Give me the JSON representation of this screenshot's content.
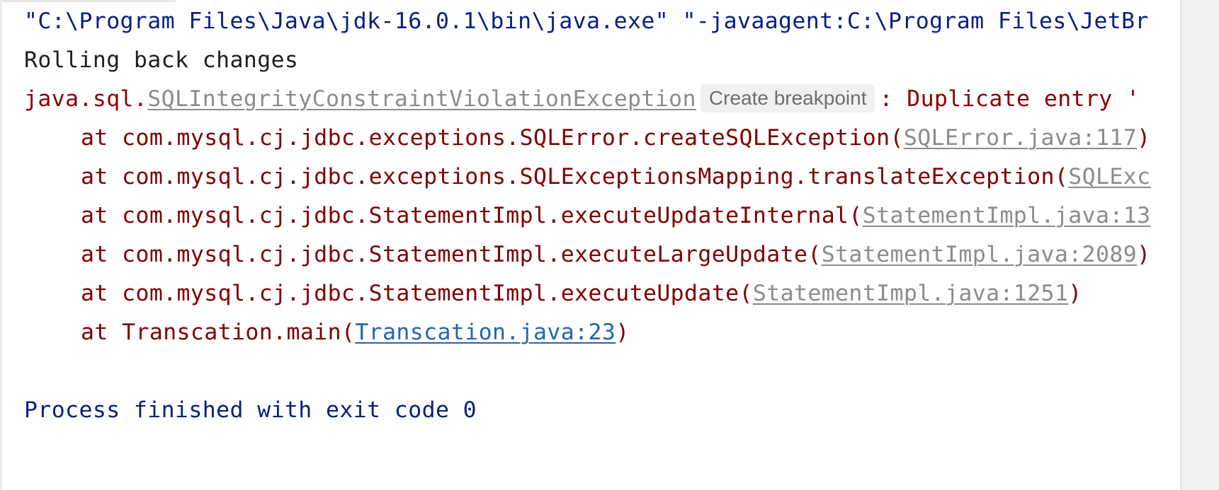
{
  "console": {
    "command_line": "\"C:\\Program Files\\Java\\jdk-16.0.1\\bin\\java.exe\" \"-javaagent:C:\\Program Files\\JetBr",
    "rollback_message": "Rolling back changes",
    "exception": {
      "prefix": "java.sql.",
      "class_name": "SQLIntegrityConstraintViolationException",
      "breakpoint_label": "Create breakpoint",
      "message": ": Duplicate entry '"
    },
    "stack_trace": [
      {
        "method": "at com.mysql.cj.jdbc.exceptions.SQLError.createSQLException(",
        "source": "SQLError.java:117",
        "suffix": ")"
      },
      {
        "method": "at com.mysql.cj.jdbc.exceptions.SQLExceptionsMapping.translateException(",
        "source": "SQLExc",
        "suffix": ""
      },
      {
        "method": "at com.mysql.cj.jdbc.StatementImpl.executeUpdateInternal(",
        "source": "StatementImpl.java:13",
        "suffix": ""
      },
      {
        "method": "at com.mysql.cj.jdbc.StatementImpl.executeLargeUpdate(",
        "source": "StatementImpl.java:2089",
        "suffix": ")"
      },
      {
        "method": "at com.mysql.cj.jdbc.StatementImpl.executeUpdate(",
        "source": "StatementImpl.java:1251",
        "suffix": ")"
      },
      {
        "method": "at Transcation.main(",
        "source": "Transcation.java:23",
        "suffix": ")"
      }
    ],
    "exit_message": "Process finished with exit code 0"
  },
  "colors": {
    "command": "#06217f",
    "error": "#8b0000",
    "library_link": "#8c8c8c",
    "user_link": "#2266b0",
    "background": "#ffffff"
  }
}
